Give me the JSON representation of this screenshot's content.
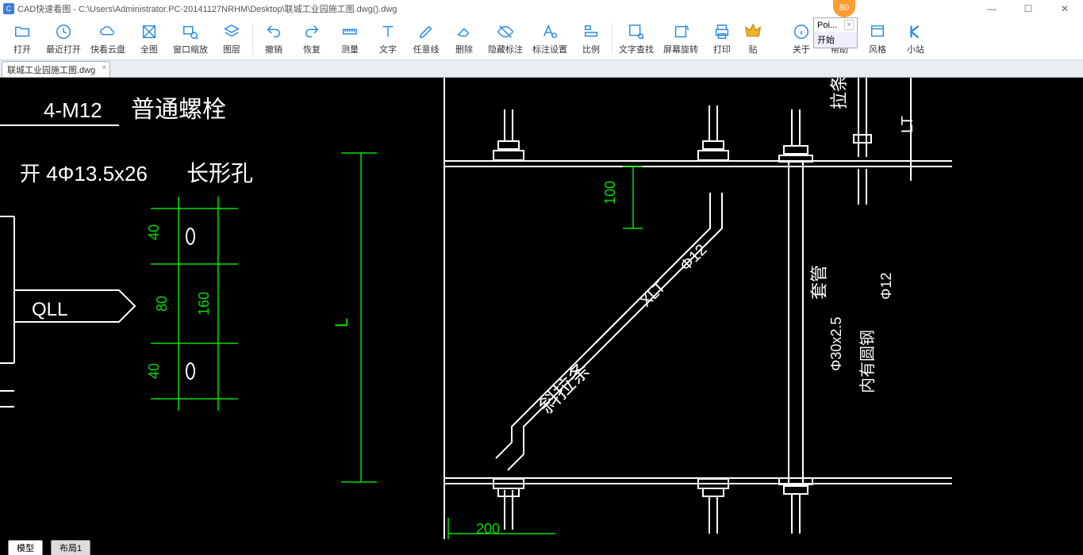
{
  "title": "CAD快速看图 - C:\\Users\\Administrator.PC-20141127NRHM\\Desktop\\联城工业园施工图.dwg().dwg",
  "badge": "80",
  "toolbar": [
    {
      "id": "open",
      "label": "打开"
    },
    {
      "id": "recent",
      "label": "最近打开"
    },
    {
      "id": "cloud",
      "label": "快看云盘"
    },
    {
      "id": "fullview",
      "label": "全图"
    },
    {
      "id": "zoomwin",
      "label": "窗口缩放"
    },
    {
      "id": "layers",
      "label": "图层"
    },
    {
      "id": "undo",
      "label": "撤销"
    },
    {
      "id": "redo",
      "label": "恢复"
    },
    {
      "id": "measure",
      "label": "测量"
    },
    {
      "id": "text",
      "label": "文字"
    },
    {
      "id": "freeline",
      "label": "任意线"
    },
    {
      "id": "delete",
      "label": "删除"
    },
    {
      "id": "hideann",
      "label": "隐藏标注"
    },
    {
      "id": "annset",
      "label": "标注设置"
    },
    {
      "id": "scale",
      "label": "比例"
    },
    {
      "id": "findtext",
      "label": "文字查找"
    },
    {
      "id": "rotate",
      "label": "屏幕旋转"
    },
    {
      "id": "print",
      "label": "打印"
    },
    {
      "id": "vip",
      "label": "贴"
    },
    {
      "id": "about",
      "label": "关于"
    },
    {
      "id": "help",
      "label": "帮助"
    },
    {
      "id": "style",
      "label": "风格"
    },
    {
      "id": "station",
      "label": "小站"
    }
  ],
  "popup": {
    "line1": "Poi...",
    "line2": "开始"
  },
  "filetab": {
    "name": "联城工业园施工图.dwg"
  },
  "bottom_tabs": [
    "模型",
    "布局1"
  ],
  "drawing": {
    "texts": {
      "t1": "4-M12",
      "t2": "普通螺栓",
      "t3": "开 4Φ13.5x26",
      "t4": "长形孔",
      "t5": "QLL",
      "d40a": "40",
      "d40b": "40",
      "d80": "80",
      "d160": "160",
      "dL": "L",
      "d100": "100",
      "d200": "200",
      "xlt": "XLT",
      "phi12a": "Φ12",
      "diag": "斜拉条",
      "sleeve": "套管",
      "pipe": "Φ30x2.5",
      "inner": "内有圆钢",
      "phi12b": "Φ12",
      "lace": "拉条",
      "lt": "LT"
    }
  }
}
